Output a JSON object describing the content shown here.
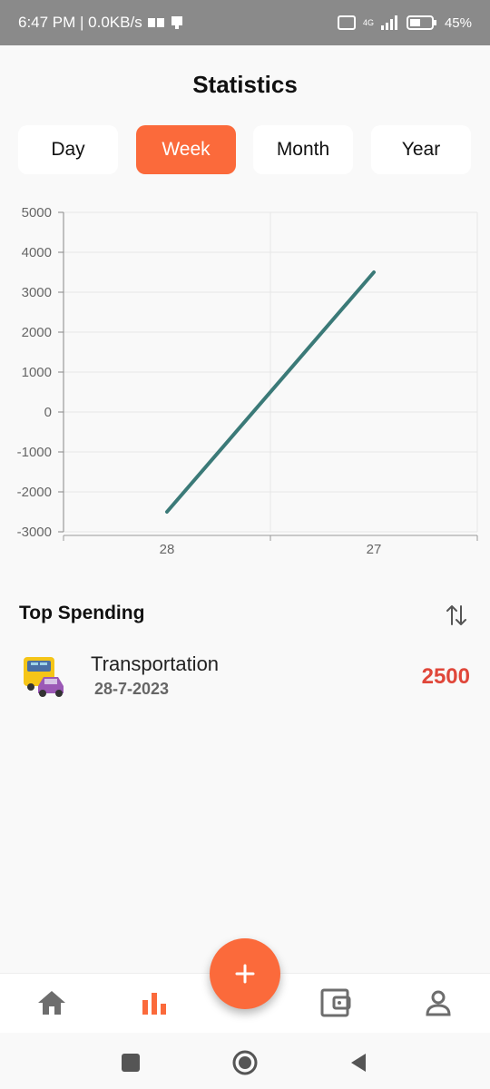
{
  "status_bar": {
    "time_speed": "6:47 PM | 0.0KB/s",
    "battery": "45%",
    "network": "4G"
  },
  "header": {
    "title": "Statistics"
  },
  "tabs": [
    {
      "label": "Day",
      "active": false
    },
    {
      "label": "Week",
      "active": true
    },
    {
      "label": "Month",
      "active": false
    },
    {
      "label": "Year",
      "active": false
    }
  ],
  "chart_data": {
    "type": "line",
    "categories": [
      "28",
      "27"
    ],
    "series": [
      {
        "values": [
          -2500,
          3500
        ],
        "color": "#3b7a78"
      }
    ],
    "yticks": [
      5000,
      4000,
      3000,
      2000,
      1000,
      0,
      -1000,
      -2000,
      -3000
    ],
    "ylim": [
      -3000,
      5000
    ],
    "grid": true,
    "title": "",
    "xlabel": "",
    "ylabel": ""
  },
  "top_spending": {
    "title": "Top Spending",
    "items": [
      {
        "name": "Transportation",
        "date": "28-7-2023",
        "amount": "2500",
        "icon": "transport-icon"
      }
    ]
  },
  "colors": {
    "accent": "#fb6a3b",
    "line": "#3b7a78",
    "expense": "#e0473a"
  },
  "nav": {
    "items": [
      "home-icon",
      "bar-chart-icon",
      "wallet-icon",
      "profile-icon"
    ],
    "fab_icon": "plus-icon"
  }
}
